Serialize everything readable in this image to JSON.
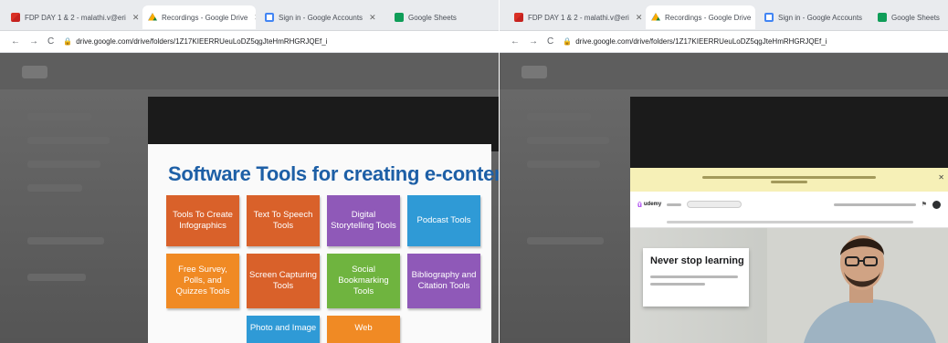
{
  "left_window": {
    "tabs": [
      {
        "title": "FDP DAY 1 & 2 - malathi.v@eri",
        "icon": "gmail-icon"
      },
      {
        "title": "Recordings - Google Drive",
        "icon": "drive-icon"
      },
      {
        "title": "Sign in - Google Accounts",
        "icon": "google-icon"
      },
      {
        "title": "Google Sheets",
        "icon": "sheets-icon"
      }
    ],
    "url": "drive.google.com/drive/folders/1Z17KIEERRUeuLoDZ5qgJteHmRHGRJQEf_i",
    "slide": {
      "title": "Software Tools for creating e-contents",
      "tiles": [
        {
          "label": "Tools To Create Infographics",
          "color": "#d9612a"
        },
        {
          "label": "Text To Speech Tools",
          "color": "#d9612a"
        },
        {
          "label": "Digital Storytelling Tools",
          "color": "#8f59b8"
        },
        {
          "label": "Podcast Tools",
          "color": "#2f9ad6"
        },
        {
          "label": "Free Survey, Polls, and Quizzes Tools",
          "color": "#f08a24"
        },
        {
          "label": "Screen Capturing Tools",
          "color": "#d9612a"
        },
        {
          "label": "Social Bookmarking Tools",
          "color": "#6fb43f"
        },
        {
          "label": "Bibliography and Citation Tools",
          "color": "#8f59b8"
        },
        {
          "label": "Photo and Image",
          "color": "#2f9ad6"
        },
        {
          "label": "Web",
          "color": "#f08a24"
        }
      ]
    }
  },
  "right_window": {
    "tabs": [
      {
        "title": "FDP DAY 1 & 2 - malathi.v@eri",
        "icon": "gmail-icon"
      },
      {
        "title": "Recordings - Google Drive",
        "icon": "drive-icon"
      },
      {
        "title": "Sign in - Google Accounts",
        "icon": "google-icon"
      },
      {
        "title": "Google Sheets",
        "icon": "sheets-icon"
      }
    ],
    "url": "drive.google.com/drive/folders/1Z17KIEERRUeuLoDZ5qgJteHmRHGRJQEf_i",
    "udemy": {
      "logo": "udemy",
      "hero_title": "Never stop learning"
    }
  }
}
